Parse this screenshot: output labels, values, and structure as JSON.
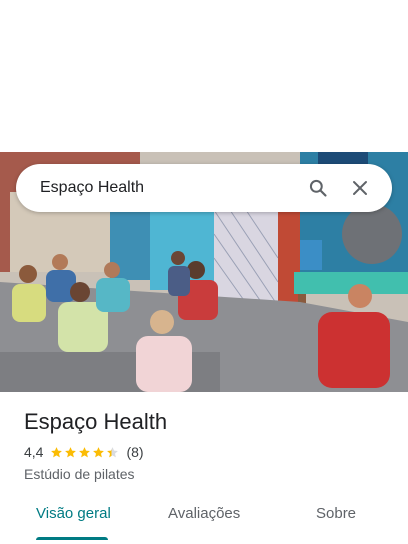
{
  "search": {
    "query": "Espaço Health"
  },
  "place": {
    "name": "Espaço Health",
    "rating": "4,4",
    "rating_value": 4.4,
    "review_count": "(8)",
    "category": "Estúdio de pilates"
  },
  "tabs": [
    {
      "label": "Visão geral",
      "active": true
    },
    {
      "label": "Avaliações",
      "active": false
    },
    {
      "label": "Sobre",
      "active": false
    }
  ],
  "colors": {
    "accent": "#007b83",
    "star": "#fbbc04"
  },
  "icons": {
    "search": "search-icon",
    "close": "close-icon",
    "star": "star-icon"
  }
}
